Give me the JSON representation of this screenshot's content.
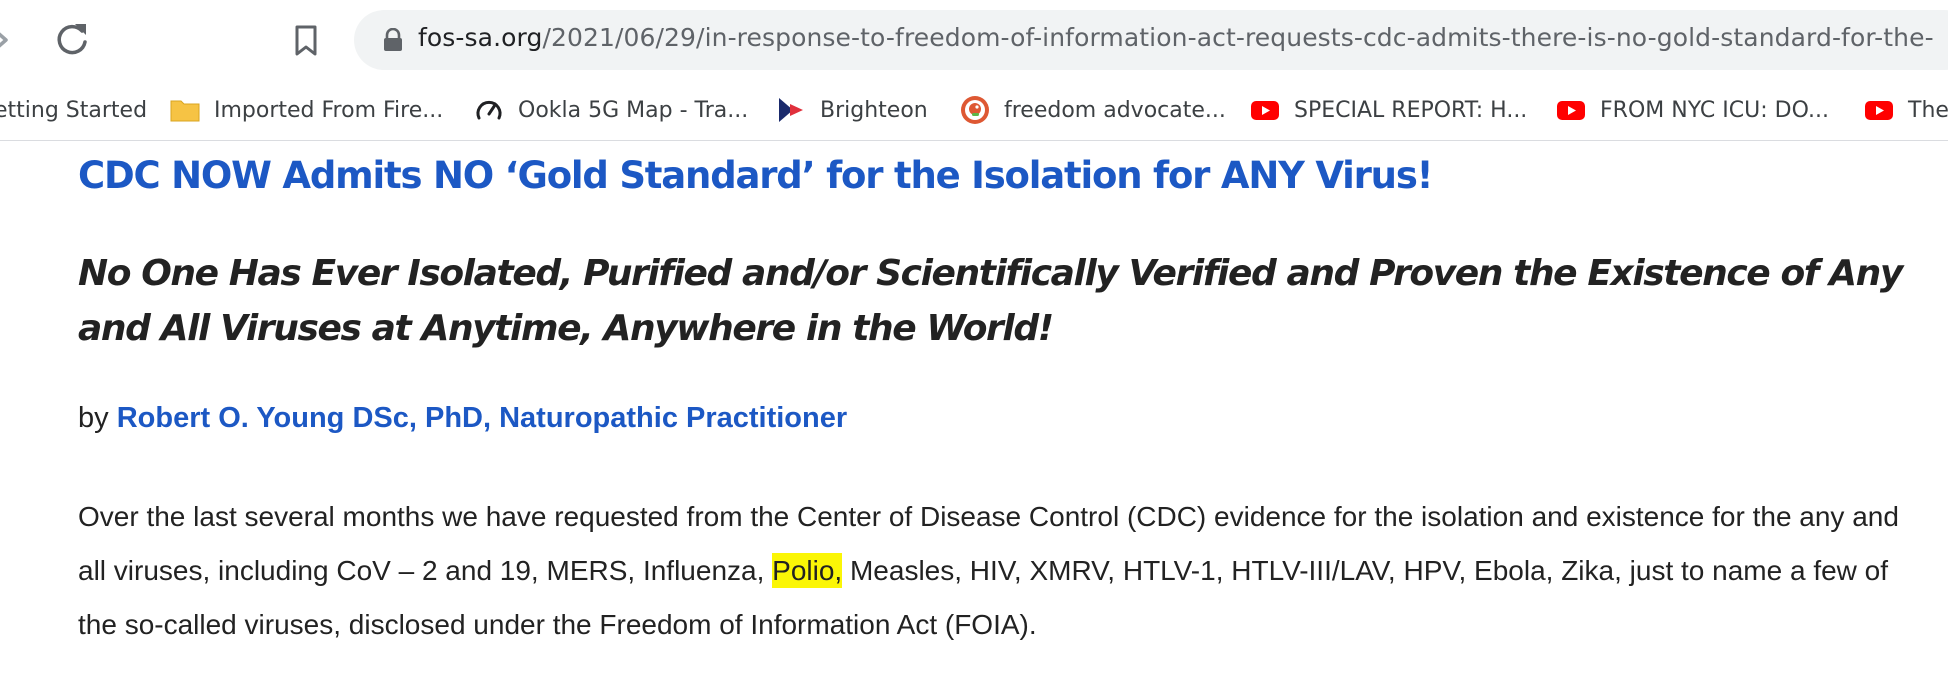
{
  "browser": {
    "url_domain": "fos-sa.org",
    "url_path": "/2021/06/29/in-response-to-freedom-of-information-act-requests-cdc-admits-there-is-no-gold-standard-for-the-",
    "bookmarks": [
      {
        "label": "etting Started",
        "icon": "getting-started-icon"
      },
      {
        "label": "Imported From Fire...",
        "icon": "folder-icon"
      },
      {
        "label": "Ookla 5G Map - Tra...",
        "icon": "speedometer-icon"
      },
      {
        "label": "Brighteon",
        "icon": "brighteon-icon"
      },
      {
        "label": "freedom advocate...",
        "icon": "duckduckgo-icon"
      },
      {
        "label": "SPECIAL REPORT: H...",
        "icon": "youtube-icon"
      },
      {
        "label": "FROM NYC ICU: DO...",
        "icon": "youtube-icon"
      },
      {
        "label": "The",
        "icon": "youtube-icon"
      }
    ],
    "colors": {
      "toolbar": "#ffffff",
      "omnibox": "#f1f3f4",
      "youtube": "#ff0000",
      "folder": "#f6c344"
    }
  },
  "article": {
    "headline": "CDC NOW Admits NO ‘Gold Standard’ for the Isolation for ANY Virus!",
    "subheadline": "No One Has Ever Isolated, Purified and/or Scientifically Verified and Proven the Existence of Any and All Viruses at Anytime, Anywhere in the World!",
    "byline_prefix": "by",
    "author": "Robert O. Young DSc, PhD, Naturopathic Practitioner",
    "body_part1": "Over the last several months we have requested from the Center of Disease Control (CDC) evidence for the isolation and existence for the any and all viruses, including CoV – 2 and 19, MERS, Influenza, ",
    "body_highlight": "Polio,",
    "body_part2": " Measles, HIV, XMRV, HTLV-1, HTLV-III/LAV, HPV, Ebola, Zika, just to name a few of the so-called viruses, disclosed under the Freedom of Information Act (FOIA).",
    "colors": {
      "link": "#1c58c4",
      "highlight": "#fbf606",
      "text": "#222222"
    }
  }
}
